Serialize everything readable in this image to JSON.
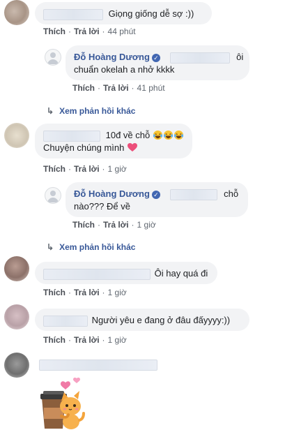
{
  "comments": [
    {
      "text": "Giọng giống dễ sợ :))",
      "actions": {
        "like": "Thích",
        "reply": "Trả lời",
        "time": "44 phút"
      },
      "reply": {
        "author": "Đỗ Hoàng Dương",
        "text_line1_suffix": "ôi",
        "text_line2": "chuẩn okelah a nhở kkkk",
        "actions": {
          "like": "Thích",
          "reply": "Trả lời",
          "time": "41 phút"
        }
      },
      "more_replies": "Xem phản hồi khác"
    },
    {
      "text_line1": "10đ về chỗ",
      "text_line2": "Chuyện chúng mình",
      "actions": {
        "like": "Thích",
        "reply": "Trả lời",
        "time": "1 giờ"
      },
      "reply": {
        "author": "Đỗ Hoàng Dương",
        "text_line1_suffix": "chỗ",
        "text_line2": "nào??? Để về",
        "actions": {
          "like": "Thích",
          "reply": "Trả lời",
          "time": "1 giờ"
        }
      },
      "more_replies": "Xem phản hồi khác"
    },
    {
      "text": "Ôi hay quá đi",
      "actions": {
        "like": "Thích",
        "reply": "Trả lời",
        "time": "1 giờ"
      }
    },
    {
      "text": "Người yêu e đang ở đâu đấyyyy:))",
      "actions": {
        "like": "Thích",
        "reply": "Trả lời",
        "time": "1 giờ"
      }
    }
  ],
  "icons": {
    "reply_arrow": "reply-arrow-icon",
    "verified": "verified-badge-icon",
    "laugh_emoji": "tears-of-joy-emoji",
    "heart": "pink-heart-emoji",
    "sticker": "cat-hugging-coffee-cup-sticker"
  },
  "colors": {
    "link": "#385898",
    "bubble": "#f2f3f5",
    "meta": "#606770",
    "verified": "#4267b2"
  }
}
